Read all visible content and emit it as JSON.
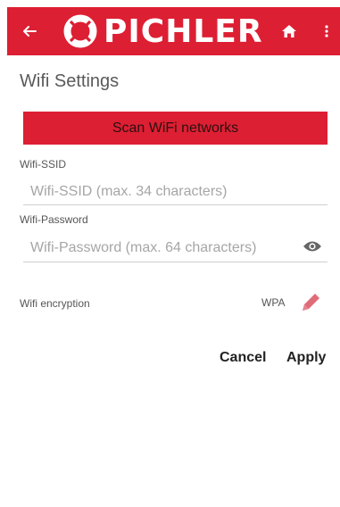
{
  "appbar": {
    "logo_text": "PICHLER",
    "icons": {
      "back": "back-arrow-icon",
      "logo": "pichler-lifebuoy-icon",
      "home": "home-icon",
      "more": "more-vertical-icon"
    },
    "color": "#dd1f33"
  },
  "page": {
    "title": "Wifi Settings"
  },
  "scan": {
    "label": "Scan WiFi networks"
  },
  "ssid": {
    "label": "Wifi-SSID",
    "placeholder": "Wifi-SSID (max. 34 characters)",
    "value": ""
  },
  "password": {
    "label": "Wifi-Password",
    "placeholder": "Wifi-Password (max. 64 characters)",
    "value": "",
    "toggle_icon": "eye-icon"
  },
  "encryption": {
    "label": "Wifi encryption",
    "value": "WPA",
    "edit_icon": "pencil-icon"
  },
  "actions": {
    "cancel": "Cancel",
    "apply": "Apply"
  },
  "colors": {
    "accent": "#dd1f33",
    "edit_icon": "#e06c7a"
  }
}
